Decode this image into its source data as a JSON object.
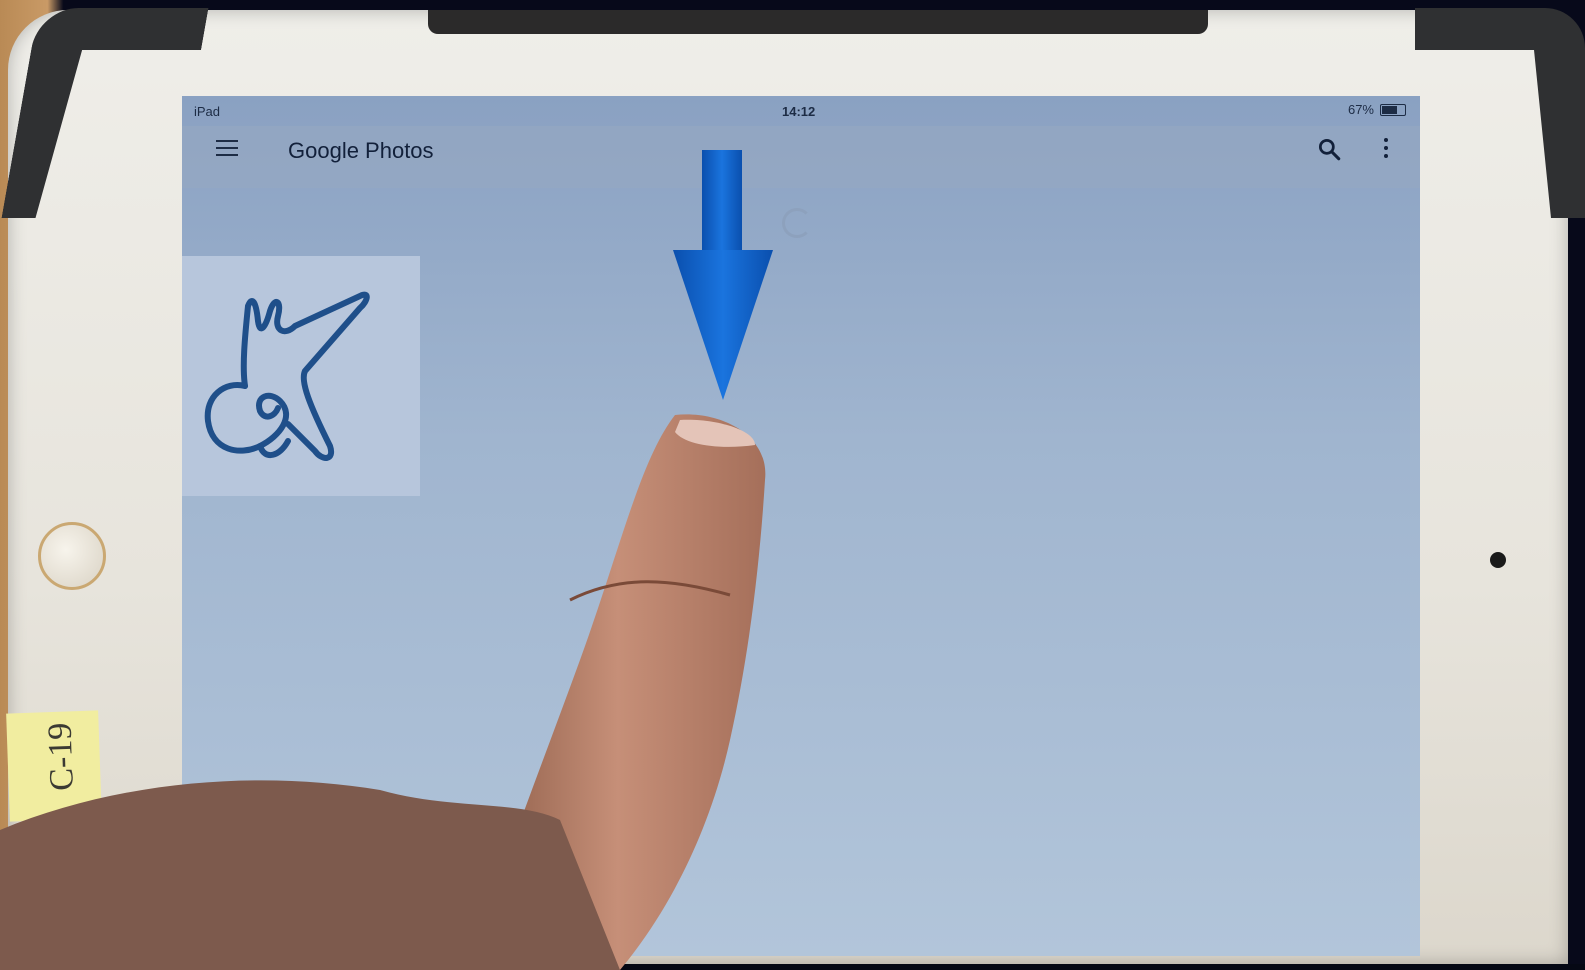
{
  "status_bar": {
    "device": "iPad",
    "time": "14:12",
    "battery": "67%"
  },
  "app_bar": {
    "title": "Google Photos"
  },
  "sticker": {
    "text": "C-19"
  },
  "icons": {
    "menu": "hamburger-menu-icon",
    "search": "search-icon",
    "more": "more-vertical-icon",
    "refresh": "refresh-spinner-icon",
    "arrow": "down-arrow-icon"
  },
  "colors": {
    "arrow_blue": "#0a5fc4",
    "screen_tint": "#9fb3cd",
    "logo_blue": "#1f4f8a"
  }
}
